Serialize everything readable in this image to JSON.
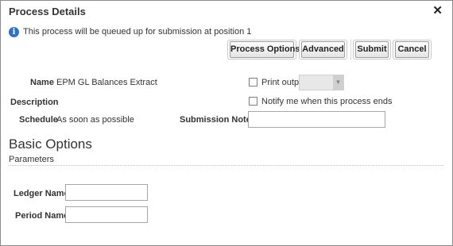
{
  "dialog": {
    "title": "Process Details",
    "close_glyph": "✕",
    "close_icon": "close-icon",
    "info_icon": "info-icon",
    "info_message": "This process will be queued up for submission at position 1"
  },
  "toolbar": {
    "process_options_label": "Process Options",
    "advanced_label": "Advanced",
    "submit_label": "Submit",
    "cancel_label": "Cancel"
  },
  "details": {
    "name_label": "Name",
    "name_value": "EPM GL Balances Extract",
    "description_label": "Description",
    "schedule_label": "Schedule",
    "schedule_value": "As soon as possible",
    "print_output_label": "Print output",
    "print_output_checked": false,
    "notify_label": "Notify me when this process ends",
    "notify_checked": false,
    "submission_notes_label": "Submission Notes",
    "submission_notes_value": ""
  },
  "basic_options": {
    "title": "Basic Options",
    "subtitle": "Parameters",
    "ledger_name_label": "Ledger Name",
    "ledger_name_value": "",
    "period_name_label": "Period Name",
    "period_name_value": ""
  },
  "colors": {
    "info_icon": "#2f72c4",
    "dialog_border": "#8a8a8a"
  }
}
